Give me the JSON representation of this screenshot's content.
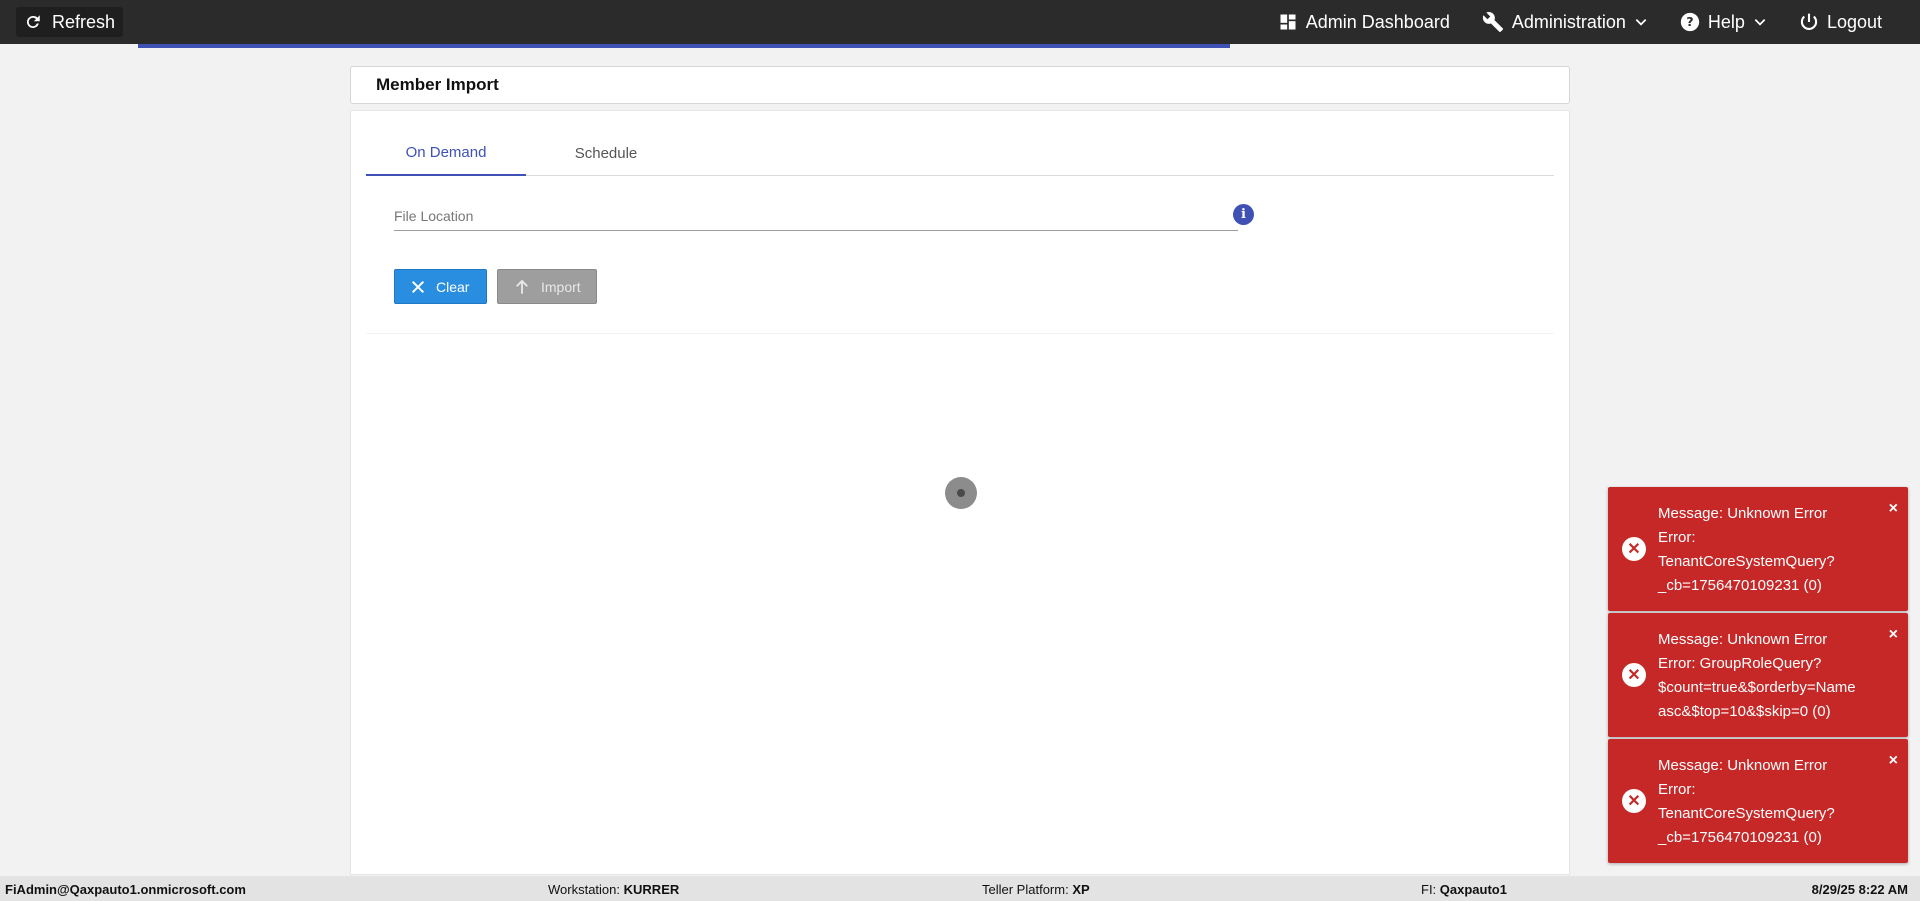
{
  "topbar": {
    "refresh_label": "Refresh",
    "nav": {
      "admin_dashboard": "Admin Dashboard",
      "administration": "Administration",
      "help": "Help",
      "logout": "Logout"
    }
  },
  "page": {
    "title": "Member Import",
    "tabs": [
      "On Demand",
      "Schedule"
    ],
    "active_tab": "On Demand",
    "file_location": {
      "placeholder": "File Location",
      "value": ""
    },
    "buttons": {
      "clear": "Clear",
      "import": "Import"
    }
  },
  "toasts": [
    {
      "line1": "Message: Unknown Error",
      "line2": "Error:",
      "line3": "TenantCoreSystemQuery?",
      "line4": "_cb=1756470109231 (0)",
      "close": "×"
    },
    {
      "line1": "Message: Unknown Error",
      "line2": "Error: GroupRoleQuery?",
      "line3": "$count=true&$orderby=Name",
      "line4": "asc&$top=10&$skip=0 (0)",
      "close": "×"
    },
    {
      "line1": "Message: Unknown Error",
      "line2": "Error:",
      "line3": "TenantCoreSystemQuery?",
      "line4": "_cb=1756470109231 (0)",
      "close": "×"
    }
  ],
  "statusbar": {
    "user": "FiAdmin@Qaxpauto1.onmicrosoft.com",
    "workstation_label": "Workstation:",
    "workstation_value": "KURRER",
    "platform_label": "Teller Platform:",
    "platform_value": "XP",
    "fi_label": "FI:",
    "fi_value": "Qaxpauto1",
    "datetime": "8/29/25 8:22 AM"
  },
  "colors": {
    "accent": "#3f51b5",
    "clear_button": "#2a8ee0",
    "toast_error": "#c62828",
    "topbar": "#2b2b2b"
  },
  "icons": {
    "refresh": "refresh-icon",
    "admin_dashboard": "dashboard-icon",
    "administration": "wrench-icon",
    "help": "help-circle-icon",
    "logout": "power-icon",
    "info": "info-icon",
    "clear": "close-icon",
    "import": "arrow-up-icon",
    "toast": "error-circle-icon"
  }
}
